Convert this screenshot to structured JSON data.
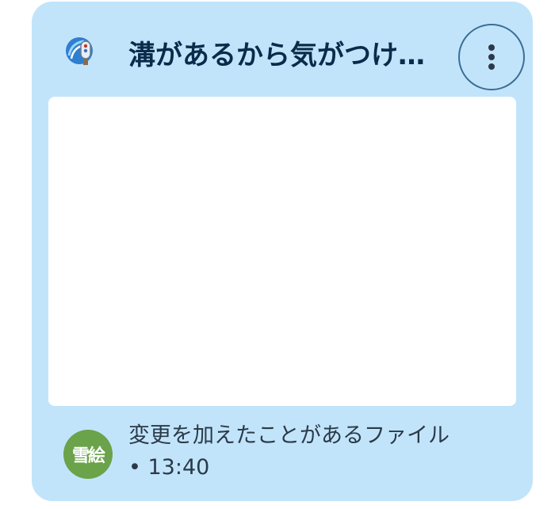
{
  "card": {
    "title": "溝があるから気がつけ…",
    "app_icon": "sketch-app-icon",
    "more_icon": "more-vert-icon",
    "owner_avatar_text": "雪絵",
    "activity_text": "変更を加えたことがあるファイル",
    "activity_time": "• 13:40",
    "colors": {
      "card_background": "#c2e4fb",
      "title": "#0a2b4a",
      "avatar_background": "#6aa34a",
      "preview_background": "#ffffff"
    }
  }
}
